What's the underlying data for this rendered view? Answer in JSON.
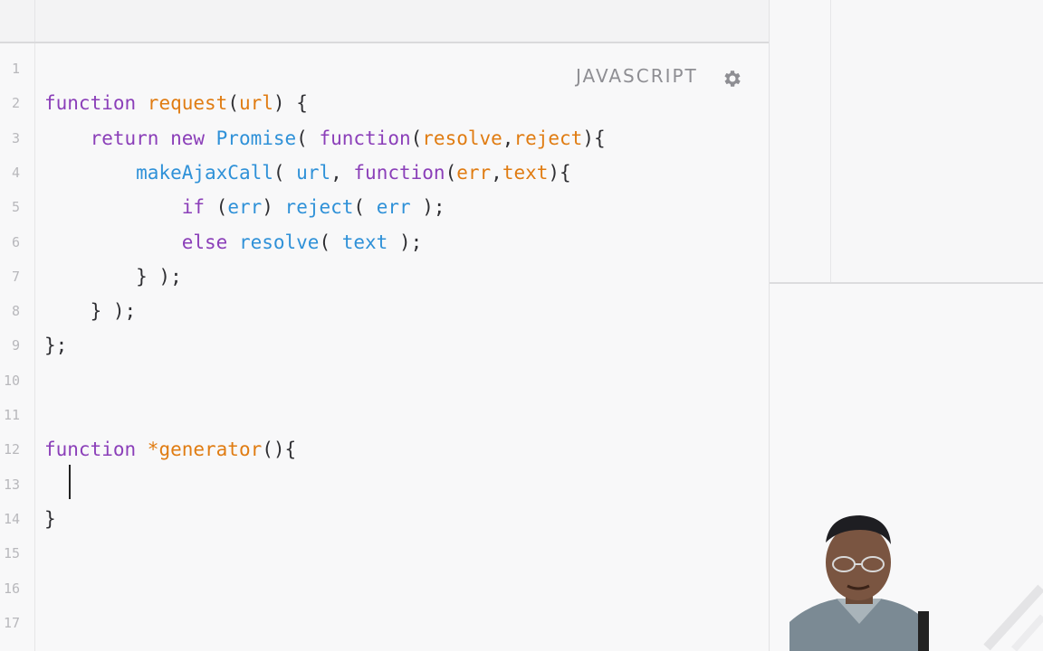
{
  "editor": {
    "language_label": "JAVASCRIPT",
    "settings_icon": "gear-icon",
    "line_numbers": [
      "1",
      "2",
      "3",
      "4",
      "5",
      "6",
      "7",
      "8",
      "9",
      "10",
      "11",
      "12",
      "13",
      "14",
      "15",
      "16",
      "17"
    ],
    "lines": [
      [],
      [
        [
          "kw",
          "function "
        ],
        [
          "fn",
          "request"
        ],
        [
          "pl",
          "("
        ],
        [
          "fn",
          "url"
        ],
        [
          "pl",
          ") {"
        ]
      ],
      [
        [
          "pl",
          "    "
        ],
        [
          "kw",
          "return new "
        ],
        [
          "id",
          "Promise"
        ],
        [
          "pl",
          "( "
        ],
        [
          "kw",
          "function"
        ],
        [
          "pl",
          "("
        ],
        [
          "fn",
          "resolve"
        ],
        [
          "pl",
          ","
        ],
        [
          "fn",
          "reject"
        ],
        [
          "pl",
          "){"
        ]
      ],
      [
        [
          "pl",
          "        "
        ],
        [
          "id",
          "makeAjaxCall"
        ],
        [
          "pl",
          "( "
        ],
        [
          "id",
          "url"
        ],
        [
          "pl",
          ", "
        ],
        [
          "kw",
          "function"
        ],
        [
          "pl",
          "("
        ],
        [
          "fn",
          "err"
        ],
        [
          "pl",
          ","
        ],
        [
          "fn",
          "text"
        ],
        [
          "pl",
          "){"
        ]
      ],
      [
        [
          "pl",
          "            "
        ],
        [
          "kw",
          "if "
        ],
        [
          "pl",
          "("
        ],
        [
          "id",
          "err"
        ],
        [
          "pl",
          ") "
        ],
        [
          "id",
          "reject"
        ],
        [
          "pl",
          "( "
        ],
        [
          "id",
          "err"
        ],
        [
          "pl",
          " );"
        ]
      ],
      [
        [
          "pl",
          "            "
        ],
        [
          "kw",
          "else "
        ],
        [
          "id",
          "resolve"
        ],
        [
          "pl",
          "( "
        ],
        [
          "id",
          "text"
        ],
        [
          "pl",
          " );"
        ]
      ],
      [
        [
          "pl",
          "        } );"
        ]
      ],
      [
        [
          "pl",
          "    } );"
        ]
      ],
      [
        [
          "pl",
          "};"
        ]
      ],
      [],
      [],
      [
        [
          "kw",
          "function "
        ],
        [
          "fn",
          "*generator"
        ],
        [
          "pl",
          "(){"
        ]
      ],
      [],
      [
        [
          "pl",
          "}"
        ]
      ],
      [],
      [],
      []
    ]
  },
  "colors": {
    "keyword": "#8b3fb9",
    "function_name": "#e07c12",
    "identifier": "#2f91d8",
    "plain": "#2f2f33"
  }
}
